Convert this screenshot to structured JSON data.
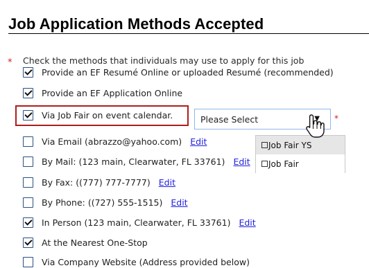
{
  "section": {
    "title": "Job Application Methods Accepted",
    "instruction": "Check the methods that individuals may use to apply for this job",
    "required_marker": "*"
  },
  "methods": [
    {
      "label": "Provide an EF Resumé Online or uploaded Resumé (recommended)",
      "checked": true,
      "edit": ""
    },
    {
      "label": "Provide an EF Application Online",
      "checked": true,
      "edit": ""
    },
    {
      "label": "Via Job Fair on event calendar.",
      "checked": true,
      "edit": ""
    },
    {
      "label": "Via Email (abrazzo@yahoo.com)",
      "checked": false,
      "edit": "Edit"
    },
    {
      "label": "By Mail: (123 main, Clearwater, FL 33761)",
      "checked": false,
      "edit": "Edit"
    },
    {
      "label": "By Fax: ((777) 777-7777)",
      "checked": false,
      "edit": "Edit"
    },
    {
      "label": "By Phone: ((727) 555-1515)",
      "checked": false,
      "edit": "Edit"
    },
    {
      "label": "In Person (123 main, Clearwater, FL 33761)",
      "checked": true,
      "edit": "Edit"
    },
    {
      "label": "At the Nearest One-Stop",
      "checked": true,
      "edit": ""
    },
    {
      "label": "Via Company Website (Address provided below)",
      "checked": false,
      "edit": ""
    }
  ],
  "job_fair_select": {
    "value": "Please Select",
    "required_marker": "*",
    "options": [
      "Job Fair YS",
      "Job Fair"
    ]
  },
  "colors": {
    "highlight": "#b01c1c",
    "link": "#2020dd",
    "required": "#cc2222",
    "checkbox_border": "#2b4f7f"
  }
}
